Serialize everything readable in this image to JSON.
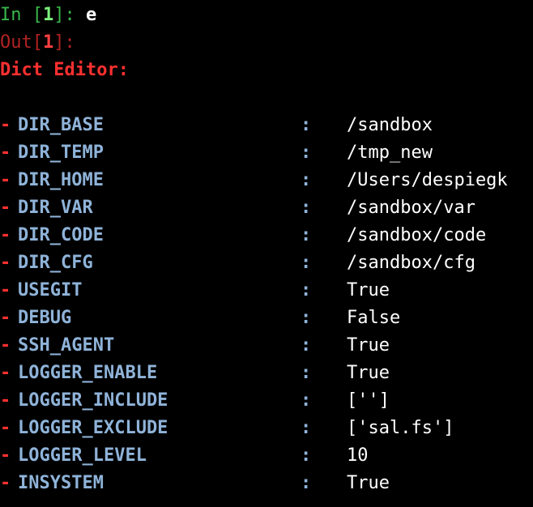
{
  "prompt": {
    "in_label": "In [",
    "in_number": "1",
    "in_close": "]: ",
    "command": "e",
    "out_label": "Out[",
    "out_number": "1",
    "out_close": "]:"
  },
  "editor_title": "Dict Editor:",
  "separator": ":",
  "entries": [
    {
      "key": "DIR_BASE",
      "value": "/sandbox"
    },
    {
      "key": "DIR_TEMP",
      "value": "/tmp_new"
    },
    {
      "key": "DIR_HOME",
      "value": "/Users/despiegk"
    },
    {
      "key": "DIR_VAR",
      "value": "/sandbox/var"
    },
    {
      "key": "DIR_CODE",
      "value": "/sandbox/code"
    },
    {
      "key": "DIR_CFG",
      "value": "/sandbox/cfg"
    },
    {
      "key": "USEGIT",
      "value": "True"
    },
    {
      "key": "DEBUG",
      "value": "False"
    },
    {
      "key": "SSH_AGENT",
      "value": "True"
    },
    {
      "key": "LOGGER_ENABLE",
      "value": "True"
    },
    {
      "key": "LOGGER_INCLUDE",
      "value": "['']"
    },
    {
      "key": "LOGGER_EXCLUDE",
      "value": "['sal.fs']"
    },
    {
      "key": "LOGGER_LEVEL",
      "value": "10"
    },
    {
      "key": "INSYSTEM",
      "value": "True"
    }
  ],
  "colors": {
    "background": "#000000",
    "prompt_in": "#39b54a",
    "prompt_out": "#b22222",
    "title": "#ff3030",
    "key": "#8fb3d9",
    "value": "#ffffff"
  }
}
